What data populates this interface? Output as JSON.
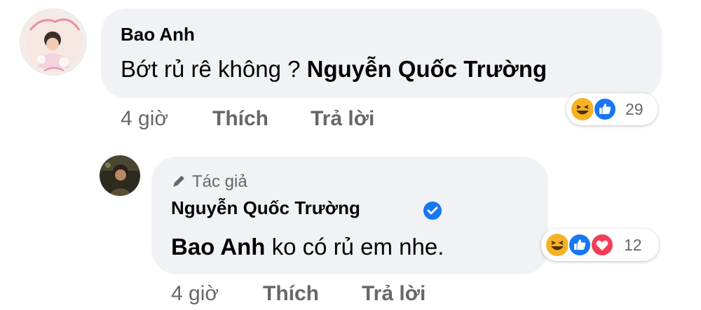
{
  "comment": {
    "author": "Bao Anh",
    "text_plain": "Bớt rủ rê không ? ",
    "mention": "Nguyễn Quốc Trường",
    "time": "4 giờ",
    "like_label": "Thích",
    "reply_label": "Trả lời",
    "reactions": {
      "icons": [
        "haha-icon",
        "like-icon"
      ],
      "count": "29"
    }
  },
  "reply": {
    "author_tag": "Tác giả",
    "author": "Nguyễn Quốc Trường",
    "verified": true,
    "mention": "Bao Anh",
    "text_plain": " ko có rủ em nhe.",
    "time": "4 giờ",
    "like_label": "Thích",
    "reply_label": "Trả lời",
    "reactions": {
      "icons": [
        "haha-icon",
        "like-icon",
        "love-icon"
      ],
      "count": "12"
    }
  },
  "colors": {
    "bubble": "#f0f2f5",
    "meta_text": "#65676b",
    "like_blue": "#1877f2",
    "love_red": "#f33e58",
    "haha_yellow": "#f7b125"
  }
}
